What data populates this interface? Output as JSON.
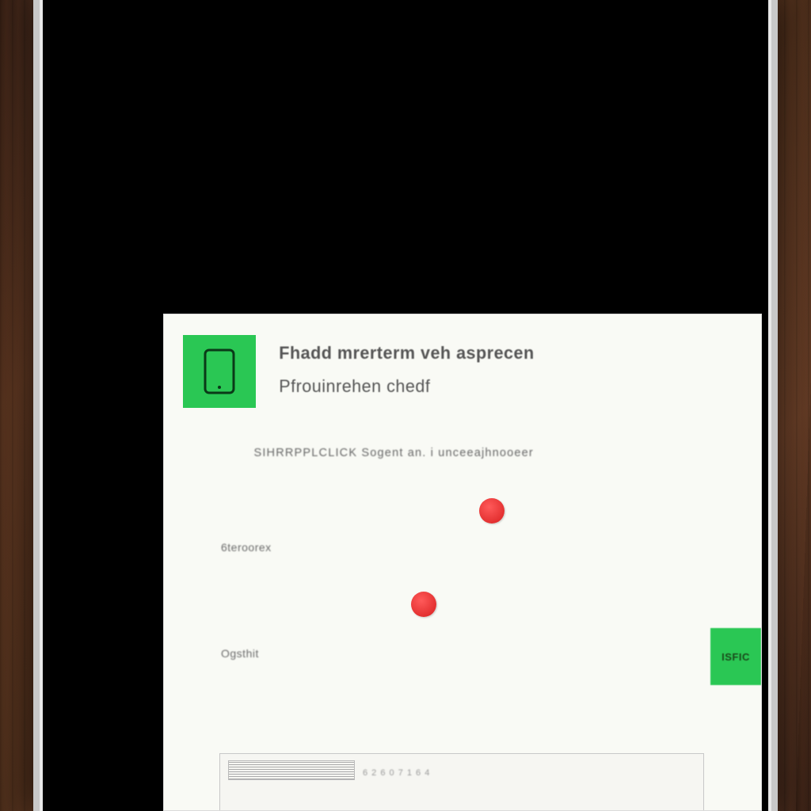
{
  "header": {
    "title": "Fhadd mrerterm veh asprecen",
    "subtitle": "Pfrouinrehen chedf"
  },
  "description": "SIHRRPPLCLICK Sogent an. i unceeajhnooeer",
  "labels": {
    "first": "6teroorex",
    "second": "Ogsthit"
  },
  "side_button": {
    "label": "ISFIC"
  },
  "bottom": {
    "text": "6 2 6 0 7 1 6 4"
  }
}
